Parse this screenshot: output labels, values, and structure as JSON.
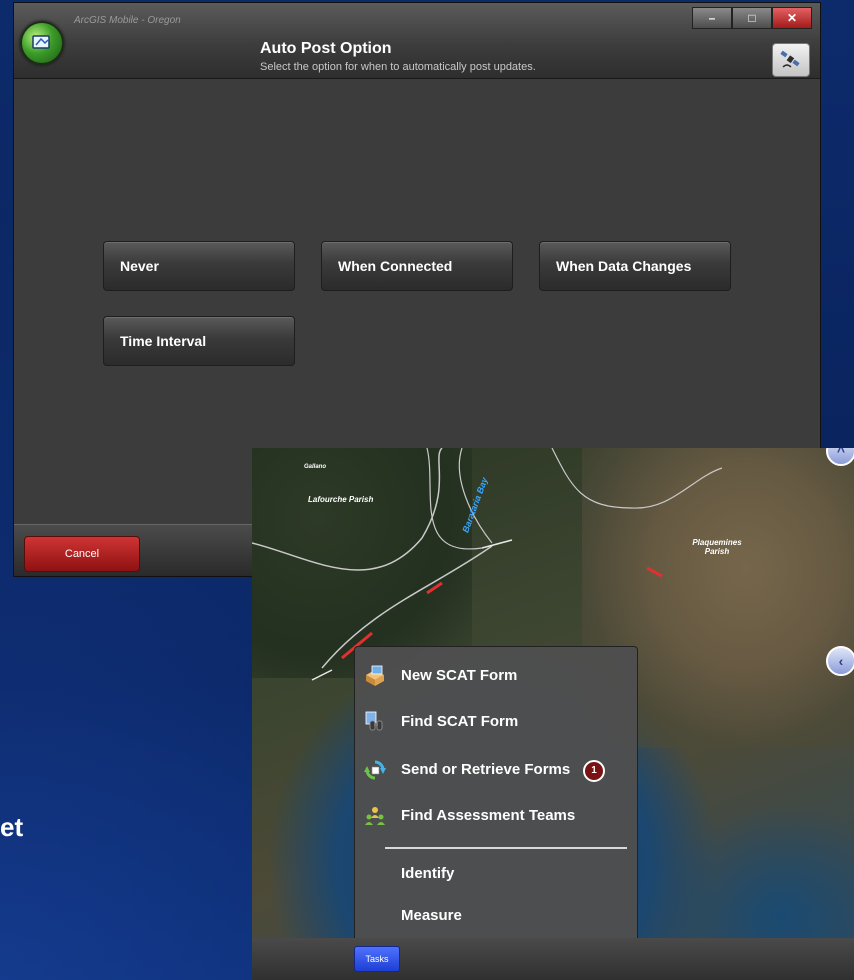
{
  "background_partial_text": "et",
  "app_window": {
    "app_name": "ArcGIS Mobile - Oregon",
    "title": "Auto Post Option",
    "subtitle": "Select the option for when to automatically post updates.",
    "window_controls": [
      "–",
      "□",
      "✕"
    ],
    "options": [
      "Never",
      "When Connected",
      "When Data Changes",
      "Time Interval"
    ],
    "cancel_label": "Cancel"
  },
  "map": {
    "labels": {
      "lafourche": "Lafourche Parish",
      "barataria": "Barataria Bay",
      "plaquemines": "Plaquemines Parish",
      "small": "Gallano"
    },
    "task_menu": {
      "items": [
        {
          "label": "New SCAT Form",
          "icon": "form-add-icon"
        },
        {
          "label": "Find SCAT Form",
          "icon": "binoculars-icon"
        },
        {
          "label": "Send or Retrieve Forms",
          "icon": "sync-icon",
          "badge": "1"
        },
        {
          "label": "Find Assessment Teams",
          "icon": "team-icon"
        }
      ],
      "tools": [
        "Identify",
        "Measure"
      ]
    },
    "tasks_label": "Tasks"
  },
  "colors": {
    "background": "#0d2a6b",
    "window": "#3c3c3c",
    "cancel": "#b52020",
    "tasks": "#2e4de6",
    "badge": "#7a1313"
  }
}
